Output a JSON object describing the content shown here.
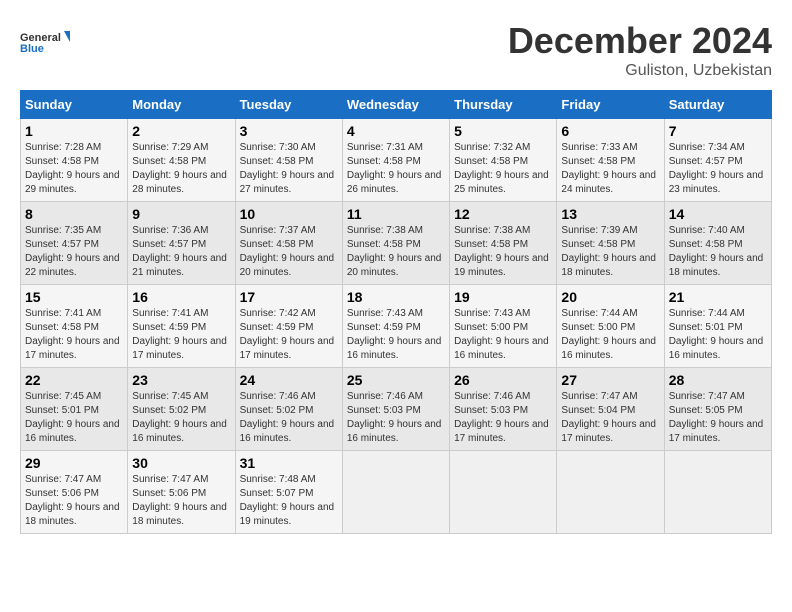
{
  "logo": {
    "line1": "General",
    "line2": "Blue"
  },
  "title": "December 2024",
  "location": "Guliston, Uzbekistan",
  "weekdays": [
    "Sunday",
    "Monday",
    "Tuesday",
    "Wednesday",
    "Thursday",
    "Friday",
    "Saturday"
  ],
  "weeks": [
    [
      {
        "day": "1",
        "sunrise": "7:28 AM",
        "sunset": "4:58 PM",
        "daylight": "9 hours and 29 minutes."
      },
      {
        "day": "2",
        "sunrise": "7:29 AM",
        "sunset": "4:58 PM",
        "daylight": "9 hours and 28 minutes."
      },
      {
        "day": "3",
        "sunrise": "7:30 AM",
        "sunset": "4:58 PM",
        "daylight": "9 hours and 27 minutes."
      },
      {
        "day": "4",
        "sunrise": "7:31 AM",
        "sunset": "4:58 PM",
        "daylight": "9 hours and 26 minutes."
      },
      {
        "day": "5",
        "sunrise": "7:32 AM",
        "sunset": "4:58 PM",
        "daylight": "9 hours and 25 minutes."
      },
      {
        "day": "6",
        "sunrise": "7:33 AM",
        "sunset": "4:58 PM",
        "daylight": "9 hours and 24 minutes."
      },
      {
        "day": "7",
        "sunrise": "7:34 AM",
        "sunset": "4:57 PM",
        "daylight": "9 hours and 23 minutes."
      }
    ],
    [
      {
        "day": "8",
        "sunrise": "7:35 AM",
        "sunset": "4:57 PM",
        "daylight": "9 hours and 22 minutes."
      },
      {
        "day": "9",
        "sunrise": "7:36 AM",
        "sunset": "4:57 PM",
        "daylight": "9 hours and 21 minutes."
      },
      {
        "day": "10",
        "sunrise": "7:37 AM",
        "sunset": "4:58 PM",
        "daylight": "9 hours and 20 minutes."
      },
      {
        "day": "11",
        "sunrise": "7:38 AM",
        "sunset": "4:58 PM",
        "daylight": "9 hours and 20 minutes."
      },
      {
        "day": "12",
        "sunrise": "7:38 AM",
        "sunset": "4:58 PM",
        "daylight": "9 hours and 19 minutes."
      },
      {
        "day": "13",
        "sunrise": "7:39 AM",
        "sunset": "4:58 PM",
        "daylight": "9 hours and 18 minutes."
      },
      {
        "day": "14",
        "sunrise": "7:40 AM",
        "sunset": "4:58 PM",
        "daylight": "9 hours and 18 minutes."
      }
    ],
    [
      {
        "day": "15",
        "sunrise": "7:41 AM",
        "sunset": "4:58 PM",
        "daylight": "9 hours and 17 minutes."
      },
      {
        "day": "16",
        "sunrise": "7:41 AM",
        "sunset": "4:59 PM",
        "daylight": "9 hours and 17 minutes."
      },
      {
        "day": "17",
        "sunrise": "7:42 AM",
        "sunset": "4:59 PM",
        "daylight": "9 hours and 17 minutes."
      },
      {
        "day": "18",
        "sunrise": "7:43 AM",
        "sunset": "4:59 PM",
        "daylight": "9 hours and 16 minutes."
      },
      {
        "day": "19",
        "sunrise": "7:43 AM",
        "sunset": "5:00 PM",
        "daylight": "9 hours and 16 minutes."
      },
      {
        "day": "20",
        "sunrise": "7:44 AM",
        "sunset": "5:00 PM",
        "daylight": "9 hours and 16 minutes."
      },
      {
        "day": "21",
        "sunrise": "7:44 AM",
        "sunset": "5:01 PM",
        "daylight": "9 hours and 16 minutes."
      }
    ],
    [
      {
        "day": "22",
        "sunrise": "7:45 AM",
        "sunset": "5:01 PM",
        "daylight": "9 hours and 16 minutes."
      },
      {
        "day": "23",
        "sunrise": "7:45 AM",
        "sunset": "5:02 PM",
        "daylight": "9 hours and 16 minutes."
      },
      {
        "day": "24",
        "sunrise": "7:46 AM",
        "sunset": "5:02 PM",
        "daylight": "9 hours and 16 minutes."
      },
      {
        "day": "25",
        "sunrise": "7:46 AM",
        "sunset": "5:03 PM",
        "daylight": "9 hours and 16 minutes."
      },
      {
        "day": "26",
        "sunrise": "7:46 AM",
        "sunset": "5:03 PM",
        "daylight": "9 hours and 17 minutes."
      },
      {
        "day": "27",
        "sunrise": "7:47 AM",
        "sunset": "5:04 PM",
        "daylight": "9 hours and 17 minutes."
      },
      {
        "day": "28",
        "sunrise": "7:47 AM",
        "sunset": "5:05 PM",
        "daylight": "9 hours and 17 minutes."
      }
    ],
    [
      {
        "day": "29",
        "sunrise": "7:47 AM",
        "sunset": "5:06 PM",
        "daylight": "9 hours and 18 minutes."
      },
      {
        "day": "30",
        "sunrise": "7:47 AM",
        "sunset": "5:06 PM",
        "daylight": "9 hours and 18 minutes."
      },
      {
        "day": "31",
        "sunrise": "7:48 AM",
        "sunset": "5:07 PM",
        "daylight": "9 hours and 19 minutes."
      },
      null,
      null,
      null,
      null
    ]
  ]
}
